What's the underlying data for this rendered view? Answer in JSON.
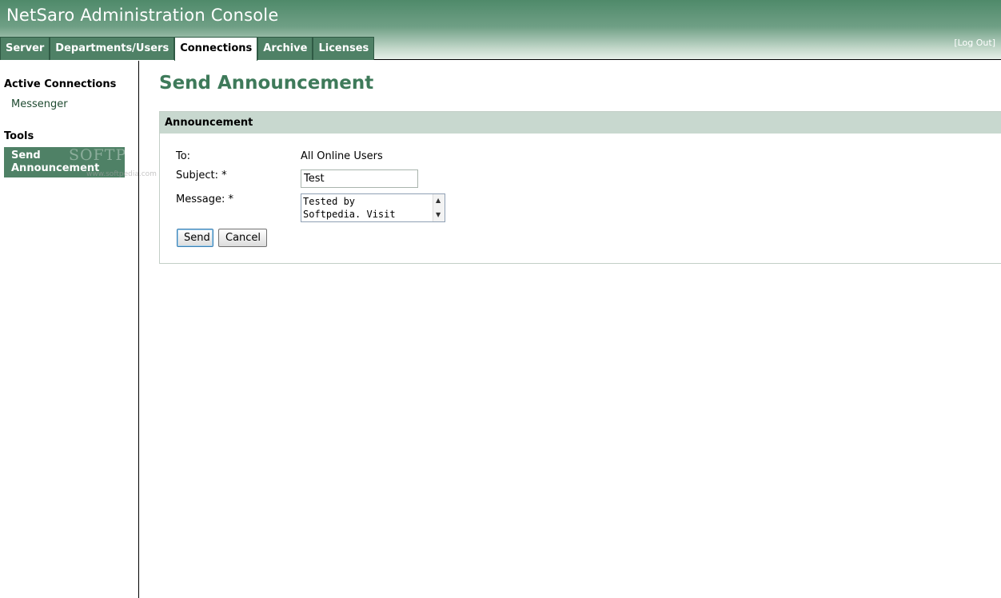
{
  "app": {
    "title": "NetSaro Administration Console"
  },
  "tabs": [
    {
      "label": "Server"
    },
    {
      "label": "Departments/Users"
    },
    {
      "label": "Connections"
    },
    {
      "label": "Archive"
    },
    {
      "label": "Licenses"
    }
  ],
  "header": {
    "logout_label": "[Log Out]"
  },
  "sidebar": {
    "active_connections_title": "Active Connections",
    "messenger_label": "Messenger",
    "tools_title": "Tools",
    "send_announcement_label": "Send Announcement"
  },
  "watermark": {
    "text": "SOFTPEDIA",
    "sub": "www.softpedia.com"
  },
  "main": {
    "page_title": "Send Announcement",
    "panel_title": "Announcement",
    "to_label": "To:",
    "to_value": "All Online Users",
    "subject_label": "Subject: *",
    "subject_value": "Test",
    "message_label": "Message: *",
    "message_value": "Tested by\nSoftpedia. Visit",
    "send_label": "Send",
    "cancel_label": "Cancel"
  },
  "icons": {
    "scroll_up": "arrow-up-icon",
    "scroll_down": "arrow-down-icon"
  },
  "colors": {
    "accent": "#4f8166",
    "title_green": "#3e7a5a",
    "panel_header": "#c8d8cf"
  }
}
